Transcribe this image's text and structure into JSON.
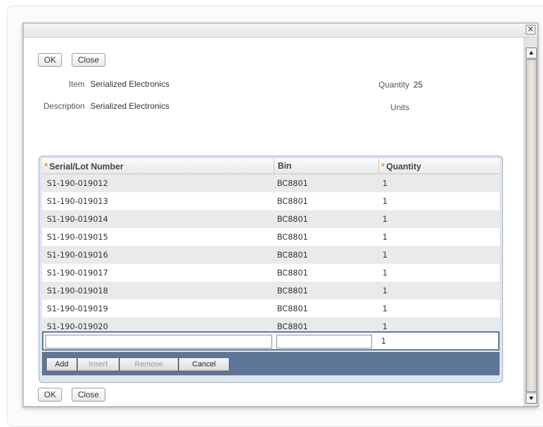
{
  "top_buttons": {
    "ok": "OK",
    "close": "Close"
  },
  "bottom_buttons": {
    "ok": "OK",
    "close": "Close"
  },
  "dialog": {
    "close_glyph": "×"
  },
  "fields": {
    "item_label": "Item",
    "item_value": "Serialized Electronics",
    "description_label": "Description",
    "description_value": "Serialized Electronics",
    "quantity_label": "Quantity",
    "quantity_value": "25",
    "units_label": "Units"
  },
  "grid": {
    "columns": [
      {
        "label": "Serial/Lot Number",
        "required": true
      },
      {
        "label": "Bin",
        "required": false
      },
      {
        "label": "Quantity",
        "required": true
      }
    ],
    "required_marker": "*",
    "rows": [
      [
        "S1-190-019012",
        "BC8801",
        "1"
      ],
      [
        "S1-190-019013",
        "BC8801",
        "1"
      ],
      [
        "S1-190-019014",
        "BC8801",
        "1"
      ],
      [
        "S1-190-019015",
        "BC8801",
        "1"
      ],
      [
        "S1-190-019016",
        "BC8801",
        "1"
      ],
      [
        "S1-190-019017",
        "BC8801",
        "1"
      ],
      [
        "S1-190-019018",
        "BC8801",
        "1"
      ],
      [
        "S1-190-019019",
        "BC8801",
        "1"
      ],
      [
        "S1-190-019020",
        "BC8801",
        "1"
      ]
    ],
    "edit_row": {
      "serial_value": "",
      "bin_value": "",
      "quantity": "1"
    },
    "toolbar": {
      "add": "Add",
      "insert": "Insert",
      "remove": "Remove",
      "cancel": "Cancel"
    }
  },
  "icons": [
    "close-icon",
    "scroll-up-arrow-icon",
    "scroll-down-arrow-icon",
    "required-asterisk-icon"
  ],
  "colors": {
    "toolbar_bg": "#5d7698",
    "required_marker": "#e8a33b",
    "row_alt": "#eaeaea"
  }
}
